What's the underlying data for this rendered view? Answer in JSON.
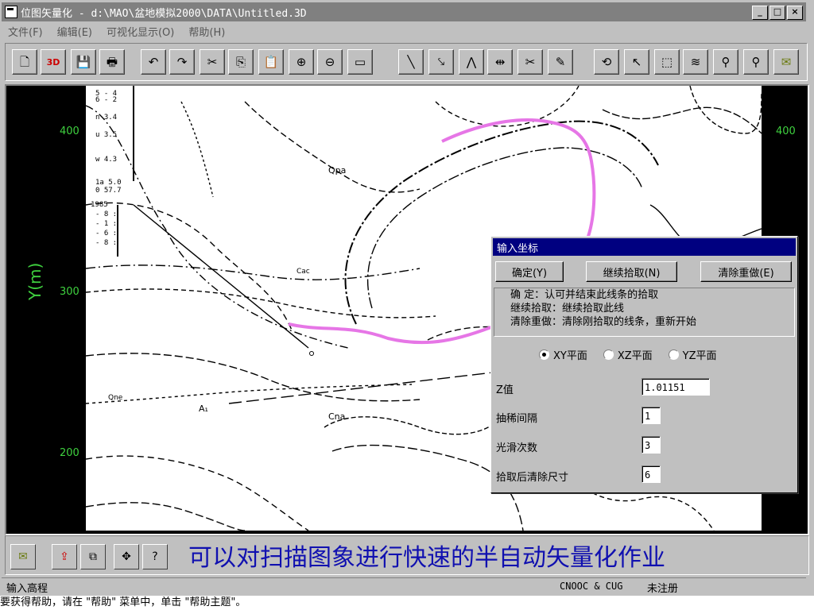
{
  "window": {
    "title": "位图矢量化 - d:\\MAO\\盆地模拟2000\\DATA\\Untitled.3D",
    "minimize": "_",
    "maximize": "□",
    "close": "×"
  },
  "menu": {
    "items": [
      "文件(F)",
      "编辑(E)",
      "可视化显示(O)",
      "帮助(H)"
    ]
  },
  "toolbar": {
    "buttons": [
      {
        "icon": "new-file-icon",
        "glyph": "🗋"
      },
      {
        "icon": "open-3d-icon",
        "glyph": "3D"
      },
      {
        "icon": "save-icon",
        "glyph": "💾"
      },
      {
        "icon": "print-icon",
        "glyph": "🖶"
      },
      {
        "icon": "undo-icon",
        "glyph": "↶"
      },
      {
        "icon": "redo-icon",
        "glyph": "↷"
      },
      {
        "icon": "cut-icon",
        "glyph": "✂"
      },
      {
        "icon": "copy-icon",
        "glyph": "⎘"
      },
      {
        "icon": "paste-icon",
        "glyph": "📋"
      },
      {
        "icon": "zoom-in-icon",
        "glyph": "⊕"
      },
      {
        "icon": "zoom-out-icon",
        "glyph": "⊖"
      },
      {
        "icon": "rectangle-icon",
        "glyph": "▭"
      },
      {
        "icon": "line-icon",
        "glyph": "╲"
      },
      {
        "icon": "trace-line-icon",
        "glyph": "⤥"
      },
      {
        "icon": "auto-trace-icon",
        "glyph": "⋀"
      },
      {
        "icon": "connect-icon",
        "glyph": "⇹"
      },
      {
        "icon": "scissors-icon",
        "glyph": "✂"
      },
      {
        "icon": "edit-icon",
        "glyph": "✎"
      },
      {
        "icon": "rotate-icon",
        "glyph": "⟲"
      },
      {
        "icon": "pointer-icon",
        "glyph": "↖"
      },
      {
        "icon": "select-icon",
        "glyph": "⬚"
      },
      {
        "icon": "layers-icon",
        "glyph": "≋"
      },
      {
        "icon": "find-icon",
        "glyph": "⚲"
      },
      {
        "icon": "find-next-icon",
        "glyph": "⚲"
      },
      {
        "icon": "envelope-icon",
        "glyph": "✉"
      }
    ]
  },
  "map": {
    "y_ticks": [
      "400",
      "300",
      "200"
    ],
    "right_tick": "400",
    "y_label": "Y(m)",
    "labels": [
      "Qpa",
      "Cac",
      "Qne",
      "Cna",
      "A₁"
    ]
  },
  "dialog": {
    "title": "输入坐标",
    "confirm_label": "确定(Y)",
    "continue_label": "继续拾取(N)",
    "clear_label": "清除重做(E)",
    "help_lines": [
      "确    定：认可并结束此线条的拾取",
      "继续拾取：继续拾取此线",
      "清除重做：清除刚拾取的线条，重新开始"
    ],
    "planes": [
      {
        "label": "XY平面",
        "selected": true
      },
      {
        "label": "XZ平面",
        "selected": false
      },
      {
        "label": "YZ平面",
        "selected": false
      }
    ],
    "fields": [
      {
        "label": "Z值",
        "value": "1.01151"
      },
      {
        "label": "抽稀间隔",
        "value": "1"
      },
      {
        "label": "光滑次数",
        "value": "3"
      },
      {
        "label": "拾取后清除尺寸",
        "value": "6"
      }
    ]
  },
  "bottom_toolbar": {
    "buttons": [
      "envelope-icon",
      "export-icon",
      "layer-stack-icon",
      "move-icon",
      "help-icon"
    ],
    "glyphs": [
      "✉",
      "⇪",
      "⧉",
      "✥",
      "?"
    ],
    "caption": "可以对扫描图象进行快速的半自动矢量化作业"
  },
  "status": {
    "left": "输入高程",
    "company": "CNOOC & CUG",
    "registration": "未注册",
    "underlay_text": "要获得帮助，请在 \"帮助\" 菜单中，单击 \"帮助主题\"。"
  },
  "colors": {
    "traced_line": "#e676e6",
    "axis_text": "#3fd13f",
    "caption": "#1010b0",
    "dialog_title": "#000080"
  }
}
